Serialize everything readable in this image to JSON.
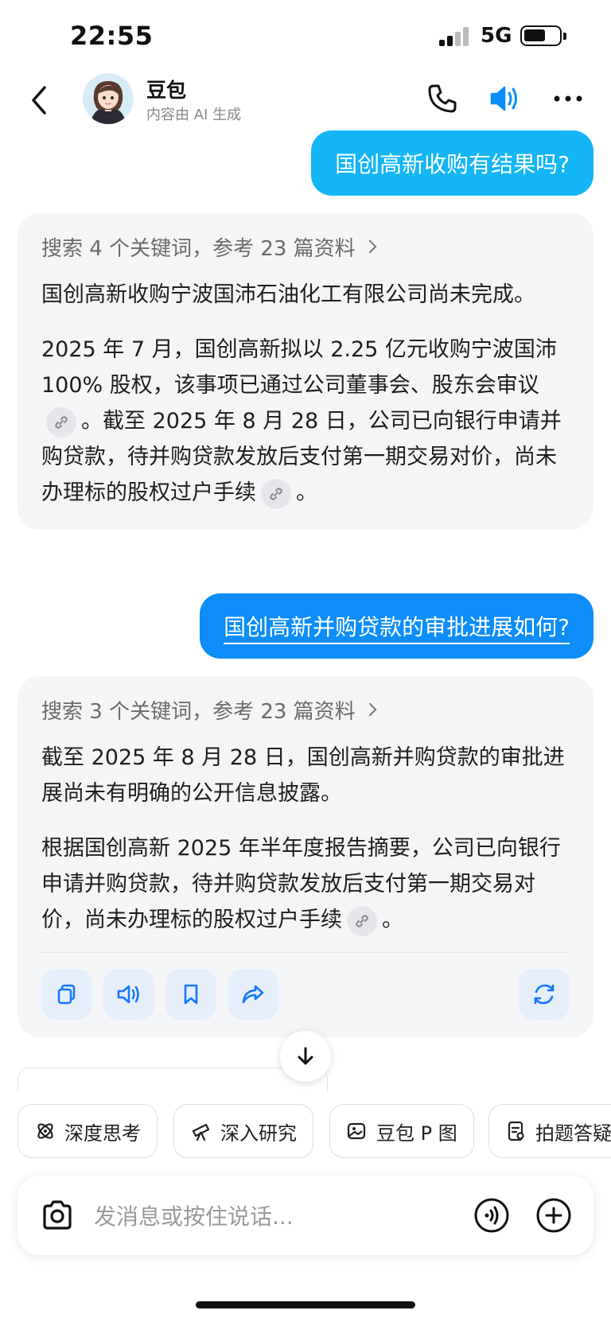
{
  "status_bar": {
    "time": "22:55",
    "network": "5G",
    "battery_level": 0.55
  },
  "header": {
    "title": "豆包",
    "subtitle": "内容由 AI 生成",
    "icons": [
      "back-arrow-icon",
      "phone-icon",
      "speaker-icon",
      "more-icon"
    ],
    "accent": "#0c8dfa"
  },
  "conversation": [
    {
      "role": "user",
      "text": "国创高新收购有结果吗?"
    },
    {
      "role": "assistant",
      "search_summary": "搜索 4 个关键词，参考 23 篇资料",
      "paragraphs": [
        {
          "text": "国创高新收购宁波国沛石油化工有限公司尚未完成。"
        },
        {
          "before": "2025 年 7 月，国创高新拟以 2.25 亿元收购宁波国沛 100% 股权，该事项已通过公司董事会、股东会审议",
          "middle": "。截至 2025 年 8 月 28 日，公司已向银行申请并购贷款，待并购贷款发放后支付第一期交易对价，尚未办理标的股权过户手续",
          "after": "。"
        }
      ]
    },
    {
      "role": "user",
      "text": "国创高新并购贷款的审批进展如何?"
    },
    {
      "role": "assistant",
      "search_summary": "搜索 3 个关键词，参考 23 篇资料",
      "paragraphs": [
        {
          "text": "截至 2025 年 8 月 28 日，国创高新并购贷款的审批进展尚未有明确的公开信息披露。"
        },
        {
          "before": "根据国创高新 2025 年半年度报告摘要，公司已向银行申请并购贷款，待并购贷款发放后支付第一期交易对价，尚未办理标的股权过户手续",
          "after": "。"
        }
      ],
      "actions": [
        "copy-icon",
        "read-aloud-icon",
        "bookmark-icon",
        "share-icon",
        "regenerate-icon"
      ]
    }
  ],
  "shortcuts": [
    "深度思考",
    "深入研究",
    "豆包 P 图",
    "拍题答疑"
  ],
  "input": {
    "placeholder": "发消息或按住说话..."
  },
  "colors": {
    "user_bubble": "#14b6f5",
    "user_bubble_active": "#0c8dfa",
    "card_bg": "#f4f5f7",
    "action_icon": "#1677ff"
  }
}
